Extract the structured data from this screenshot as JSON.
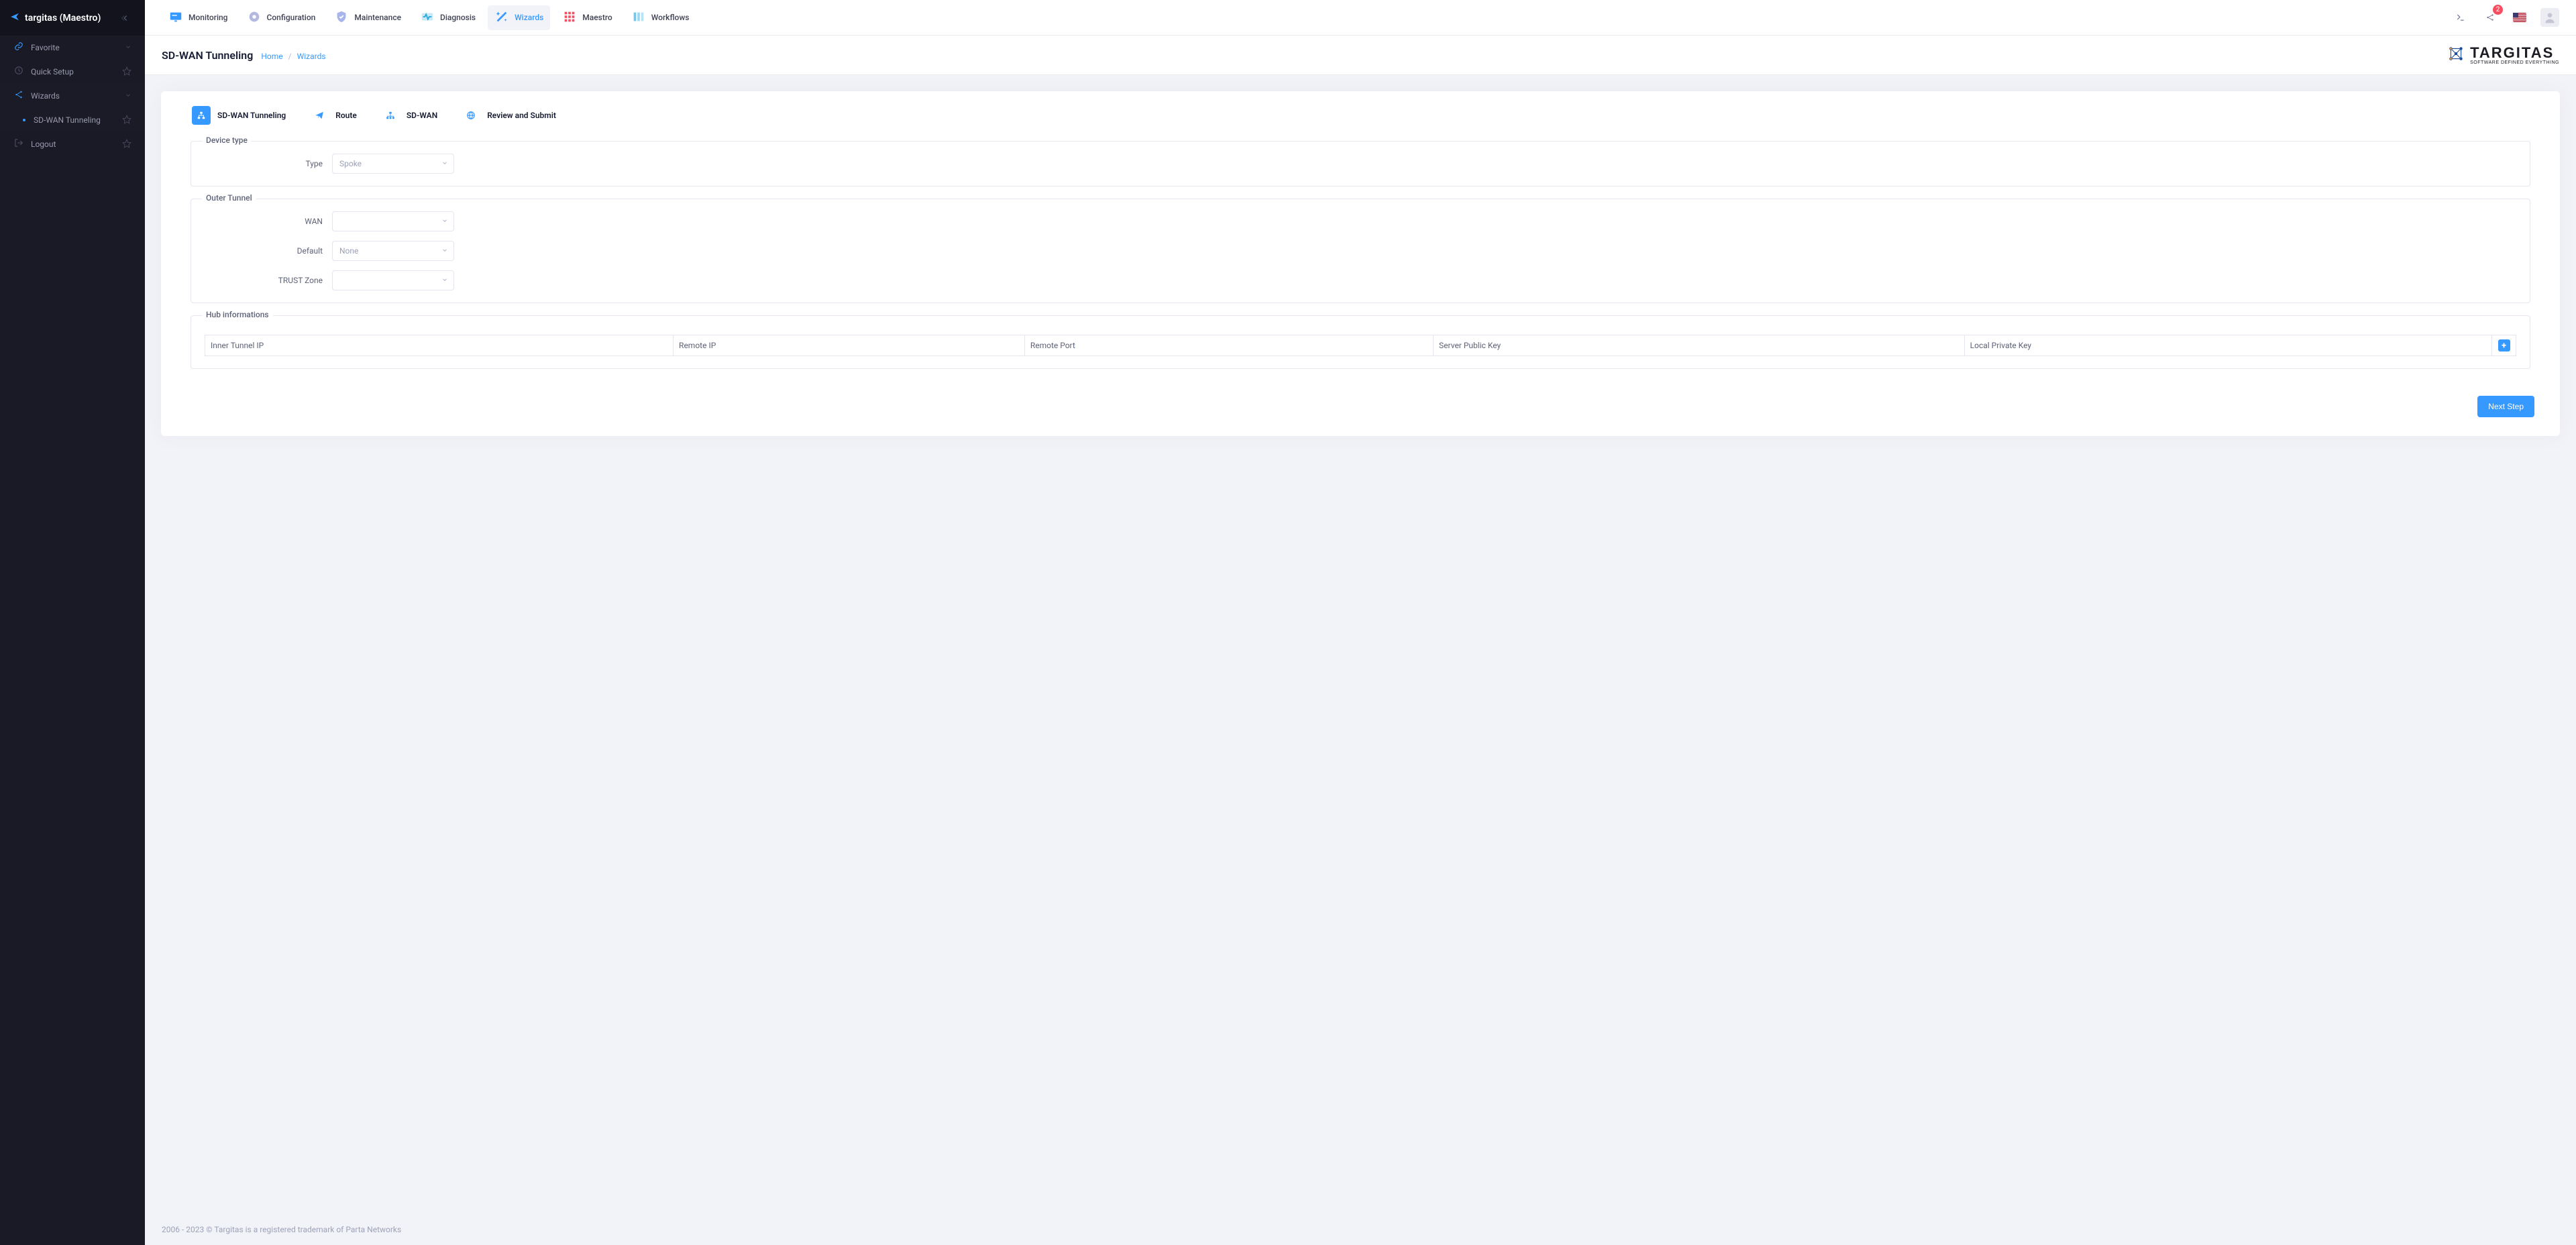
{
  "brand": {
    "title": "targitas (Maestro)",
    "logo_main": "TARGITAS",
    "logo_sub": "SOFTWARE DEFINED EVERYTHING"
  },
  "sidebar": {
    "groups": [
      {
        "icon": "link-icon",
        "label": "Favorite",
        "expandable": true
      },
      {
        "icon": "clock-icon",
        "label": "Quick Setup",
        "star": true
      },
      {
        "icon": "share-icon",
        "label": "Wizards",
        "expandable": true
      },
      {
        "icon": "logout-icon",
        "label": "Logout",
        "star": true
      }
    ],
    "wizards_children": [
      {
        "label": "SD-WAN Tunneling",
        "star": true
      }
    ]
  },
  "topnav": {
    "items": [
      {
        "label": "Monitoring",
        "icon": "monitor-icon",
        "color": "#3699ff"
      },
      {
        "label": "Configuration",
        "icon": "gear-icon",
        "color": "#b3b8e0"
      },
      {
        "label": "Maintenance",
        "icon": "shield-icon",
        "color": "#a7b5ec"
      },
      {
        "label": "Diagnosis",
        "icon": "pulse-icon",
        "color": "#26a9df"
      },
      {
        "label": "Wizards",
        "icon": "wand-icon",
        "color": "#3699ff",
        "active": true
      },
      {
        "label": "Maestro",
        "icon": "grid-icon",
        "color": "#f64e60"
      },
      {
        "label": "Workflows",
        "icon": "columns-icon",
        "color": "#6fc9f0"
      }
    ],
    "badge_count": "2"
  },
  "page": {
    "title": "SD-WAN Tunneling",
    "breadcrumb": [
      {
        "label": "Home"
      },
      {
        "label": "Wizards"
      }
    ]
  },
  "stepper": [
    {
      "label": "SD-WAN Tunneling",
      "icon": "network-icon",
      "current": true
    },
    {
      "label": "Route",
      "icon": "paper-plane-icon"
    },
    {
      "label": "SD-WAN",
      "icon": "topology-icon"
    },
    {
      "label": "Review and Submit",
      "icon": "globe-icon"
    }
  ],
  "form": {
    "device_type": {
      "legend": "Device type",
      "type_label": "Type",
      "type_value": "Spoke"
    },
    "outer_tunnel": {
      "legend": "Outer Tunnel",
      "wan_label": "WAN",
      "wan_value": "",
      "default_label": "Default",
      "default_value": "None",
      "trust_zone_label": "TRUST Zone",
      "trust_zone_value": ""
    },
    "hub": {
      "legend": "Hub informations",
      "columns": [
        "Inner Tunnel IP",
        "Remote IP",
        "Remote Port",
        "Server Public Key",
        "Local Private Key"
      ]
    }
  },
  "actions": {
    "next": "Next Step"
  },
  "footer": {
    "text": "2006 - 2023 © Targitas is a registered trademark of Parta Networks"
  }
}
